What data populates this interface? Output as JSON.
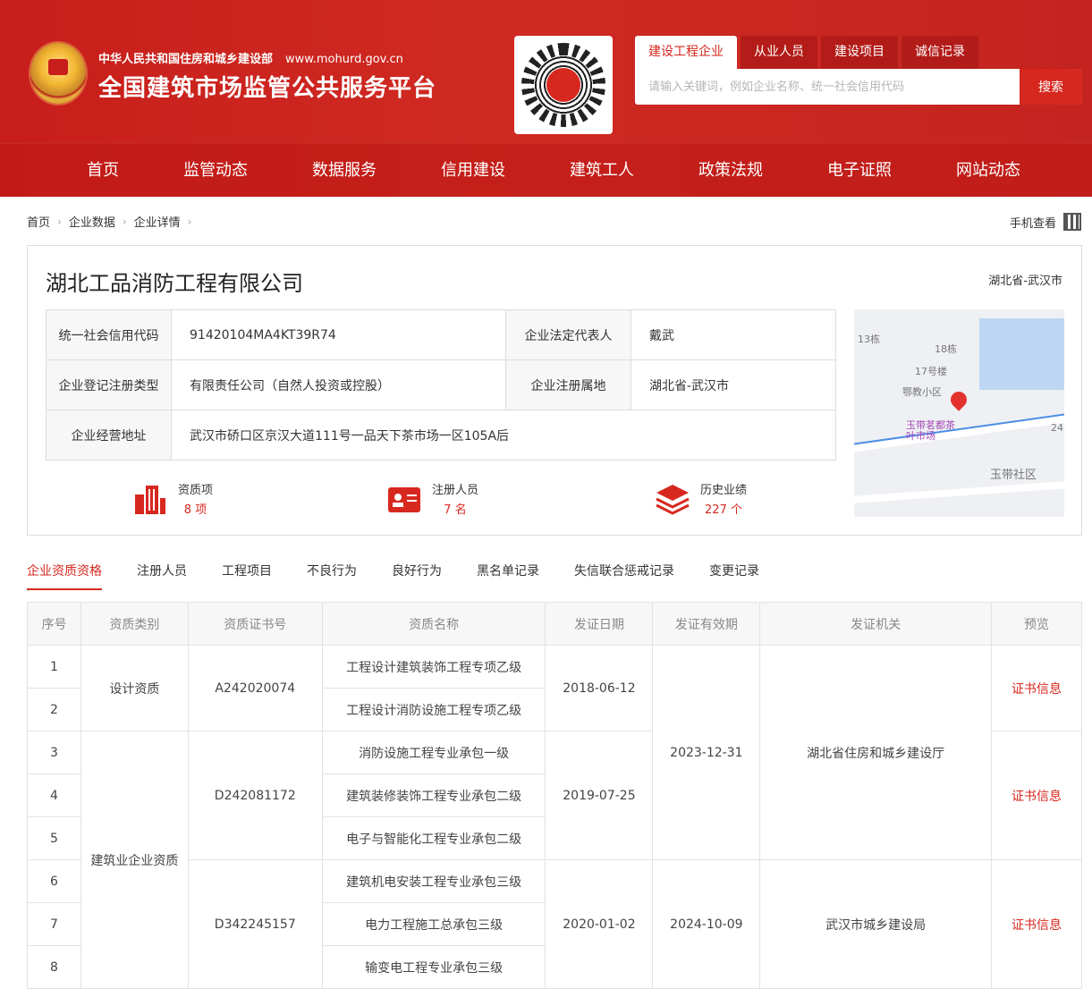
{
  "header": {
    "ministry": "中华人民共和国住房和城乡建设部",
    "url": "www.mohurd.gov.cn",
    "platform": "全国建筑市场监管公共服务平台",
    "search_tabs": [
      "建设工程企业",
      "从业人员",
      "建设项目",
      "诚信记录"
    ],
    "search_placeholder": "请输入关键词，例如企业名称、统一社会信用代码",
    "search_button": "搜索"
  },
  "nav": [
    "首页",
    "监管动态",
    "数据服务",
    "信用建设",
    "建筑工人",
    "政策法规",
    "电子证照",
    "网站动态"
  ],
  "breadcrumb": [
    "首页",
    "企业数据",
    "企业详情"
  ],
  "mobile_view": "手机查看",
  "company": {
    "name": "湖北工品消防工程有限公司",
    "region": "湖北省-武汉市",
    "info": {
      "credit_code_label": "统一社会信用代码",
      "credit_code": "91420104MA4KT39R74",
      "legal_rep_label": "企业法定代表人",
      "legal_rep": "戴武",
      "reg_type_label": "企业登记注册类型",
      "reg_type": "有限责任公司（自然人投资或控股）",
      "reg_place_label": "企业注册属地",
      "reg_place": "湖北省-武汉市",
      "address_label": "企业经营地址",
      "address": "武汉市硚口区京汉大道111号一品天下茶市场一区105A后"
    },
    "map_labels": [
      "13栋",
      "18栋",
      "17号楼",
      "鄂教小区",
      "玉带茗都茶叶市场",
      "玉带社区",
      "24"
    ],
    "stats": [
      {
        "label": "资质项",
        "value": "8 项"
      },
      {
        "label": "注册人员",
        "value": "7 名"
      },
      {
        "label": "历史业绩",
        "value": "227 个"
      }
    ]
  },
  "tabs": [
    "企业资质资格",
    "注册人员",
    "工程项目",
    "不良行为",
    "良好行为",
    "黑名单记录",
    "失信联合惩戒记录",
    "变更记录"
  ],
  "table": {
    "headers": [
      "序号",
      "资质类别",
      "资质证书号",
      "资质名称",
      "发证日期",
      "发证有效期",
      "发证机关",
      "预览"
    ],
    "rows": [
      {
        "no": "1",
        "name": "工程设计建筑装饰工程专项乙级"
      },
      {
        "no": "2",
        "name": "工程设计消防设施工程专项乙级"
      },
      {
        "no": "3",
        "name": "消防设施工程专业承包一级"
      },
      {
        "no": "4",
        "name": "建筑装修装饰工程专业承包二级"
      },
      {
        "no": "5",
        "name": "电子与智能化工程专业承包二级"
      },
      {
        "no": "6",
        "name": "建筑机电安装工程专业承包三级"
      },
      {
        "no": "7",
        "name": "电力工程施工总承包三级"
      },
      {
        "no": "8",
        "name": "输变电工程专业承包三级"
      }
    ],
    "groups": {
      "cat_design": "设计资质",
      "cat_build": "建筑业企业资质",
      "cert_1": "A242020074",
      "cert_2": "D242081172",
      "cert_3": "D342245157",
      "date_1": "2018-06-12",
      "date_2": "2019-07-25",
      "date_3": "2020-01-02",
      "valid_1": "2023-12-31",
      "valid_2": "2024-10-09",
      "org_1": "湖北省住房和城乡建设厅",
      "org_2": "武汉市城乡建设局",
      "preview": "证书信息"
    }
  }
}
